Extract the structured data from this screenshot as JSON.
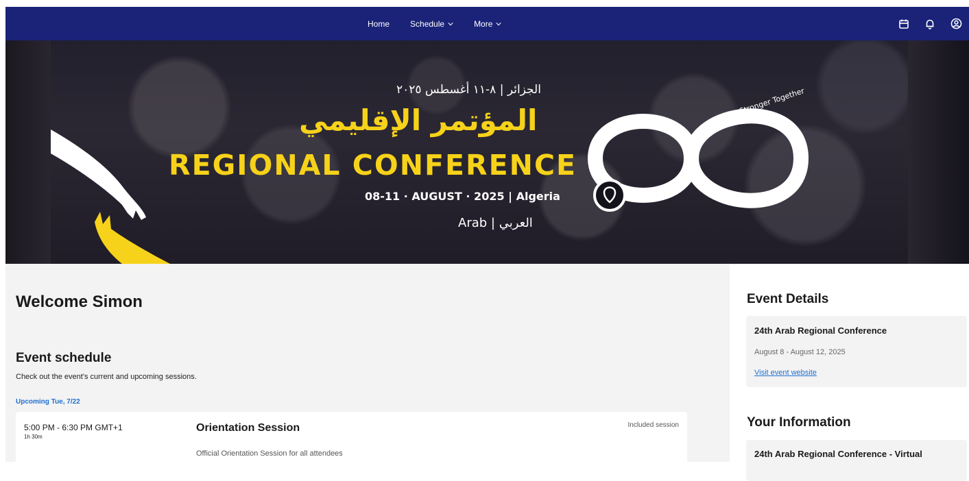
{
  "nav": {
    "home": "Home",
    "schedule": "Schedule",
    "more": "More",
    "icons": [
      "calendar-icon",
      "bell-icon",
      "user-circle-icon"
    ],
    "background": "#1a2378"
  },
  "hero": {
    "arabic_date": "الجزائر | ٨-١١ أغسطس ٢٠٢٥",
    "arabic_title": "المؤتمر الإقليمي",
    "title": "REGIONAL CONFERENCE",
    "dates": "08-11 · AUGUST · 2025 | Algeria",
    "language": "Arab | العربي",
    "slogan": "Stronger Together",
    "accent": "#f6d21a"
  },
  "main": {
    "welcome": "Welcome Simon",
    "schedule_title": "Event schedule",
    "schedule_subtitle": "Check out the event's current and upcoming sessions.",
    "upcoming_label": "Upcoming Tue, 7/22",
    "session": {
      "time": "5:00 PM - 6:30 PM GMT+1",
      "duration": "1h 30m",
      "name": "Orientation Session",
      "tag": "Included session",
      "description": "Official Orientation Session for all attendees"
    }
  },
  "sidebar": {
    "event_details_heading": "Event Details",
    "event_name": "24th Arab Regional Conference",
    "event_dates": "August 8 - August 12, 2025",
    "event_link": "Visit event website",
    "your_info_heading": "Your Information",
    "ticket_name": "24th Arab Regional Conference - Virtual"
  },
  "colors": {
    "link": "#1f6fd1",
    "page_bg": "#f3f3f3"
  }
}
